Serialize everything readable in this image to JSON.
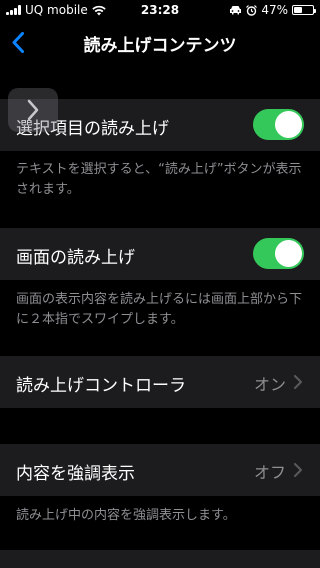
{
  "status_bar": {
    "carrier": "UQ mobile",
    "time": "23:28",
    "battery_percent": "47%",
    "battery_level": 0.47
  },
  "nav": {
    "title": "読み上げコンテンツ",
    "back_icon": "chevron-left-icon"
  },
  "rows": {
    "speak_selection": {
      "label": "選択項目の読み上げ",
      "enabled": true,
      "footer": "テキストを選択すると、“読み上げ”ボタンが表示されます。"
    },
    "speak_screen": {
      "label": "画面の読み上げ",
      "enabled": true,
      "footer": "画面の表示内容を読み上げるには画面上部から下に２本指でスワイプします。"
    },
    "speech_controller": {
      "label": "読み上げコントローラ",
      "value": "オン"
    },
    "highlight_content": {
      "label": "内容を強調表示",
      "value": "オフ",
      "footer": "読み上げ中の内容を強調表示します。"
    }
  },
  "colors": {
    "background": "#000000",
    "cell": "#1c1c1e",
    "accent": "#0a84ff",
    "toggle_on": "#34c759",
    "secondary_text": "#8e8e93"
  }
}
